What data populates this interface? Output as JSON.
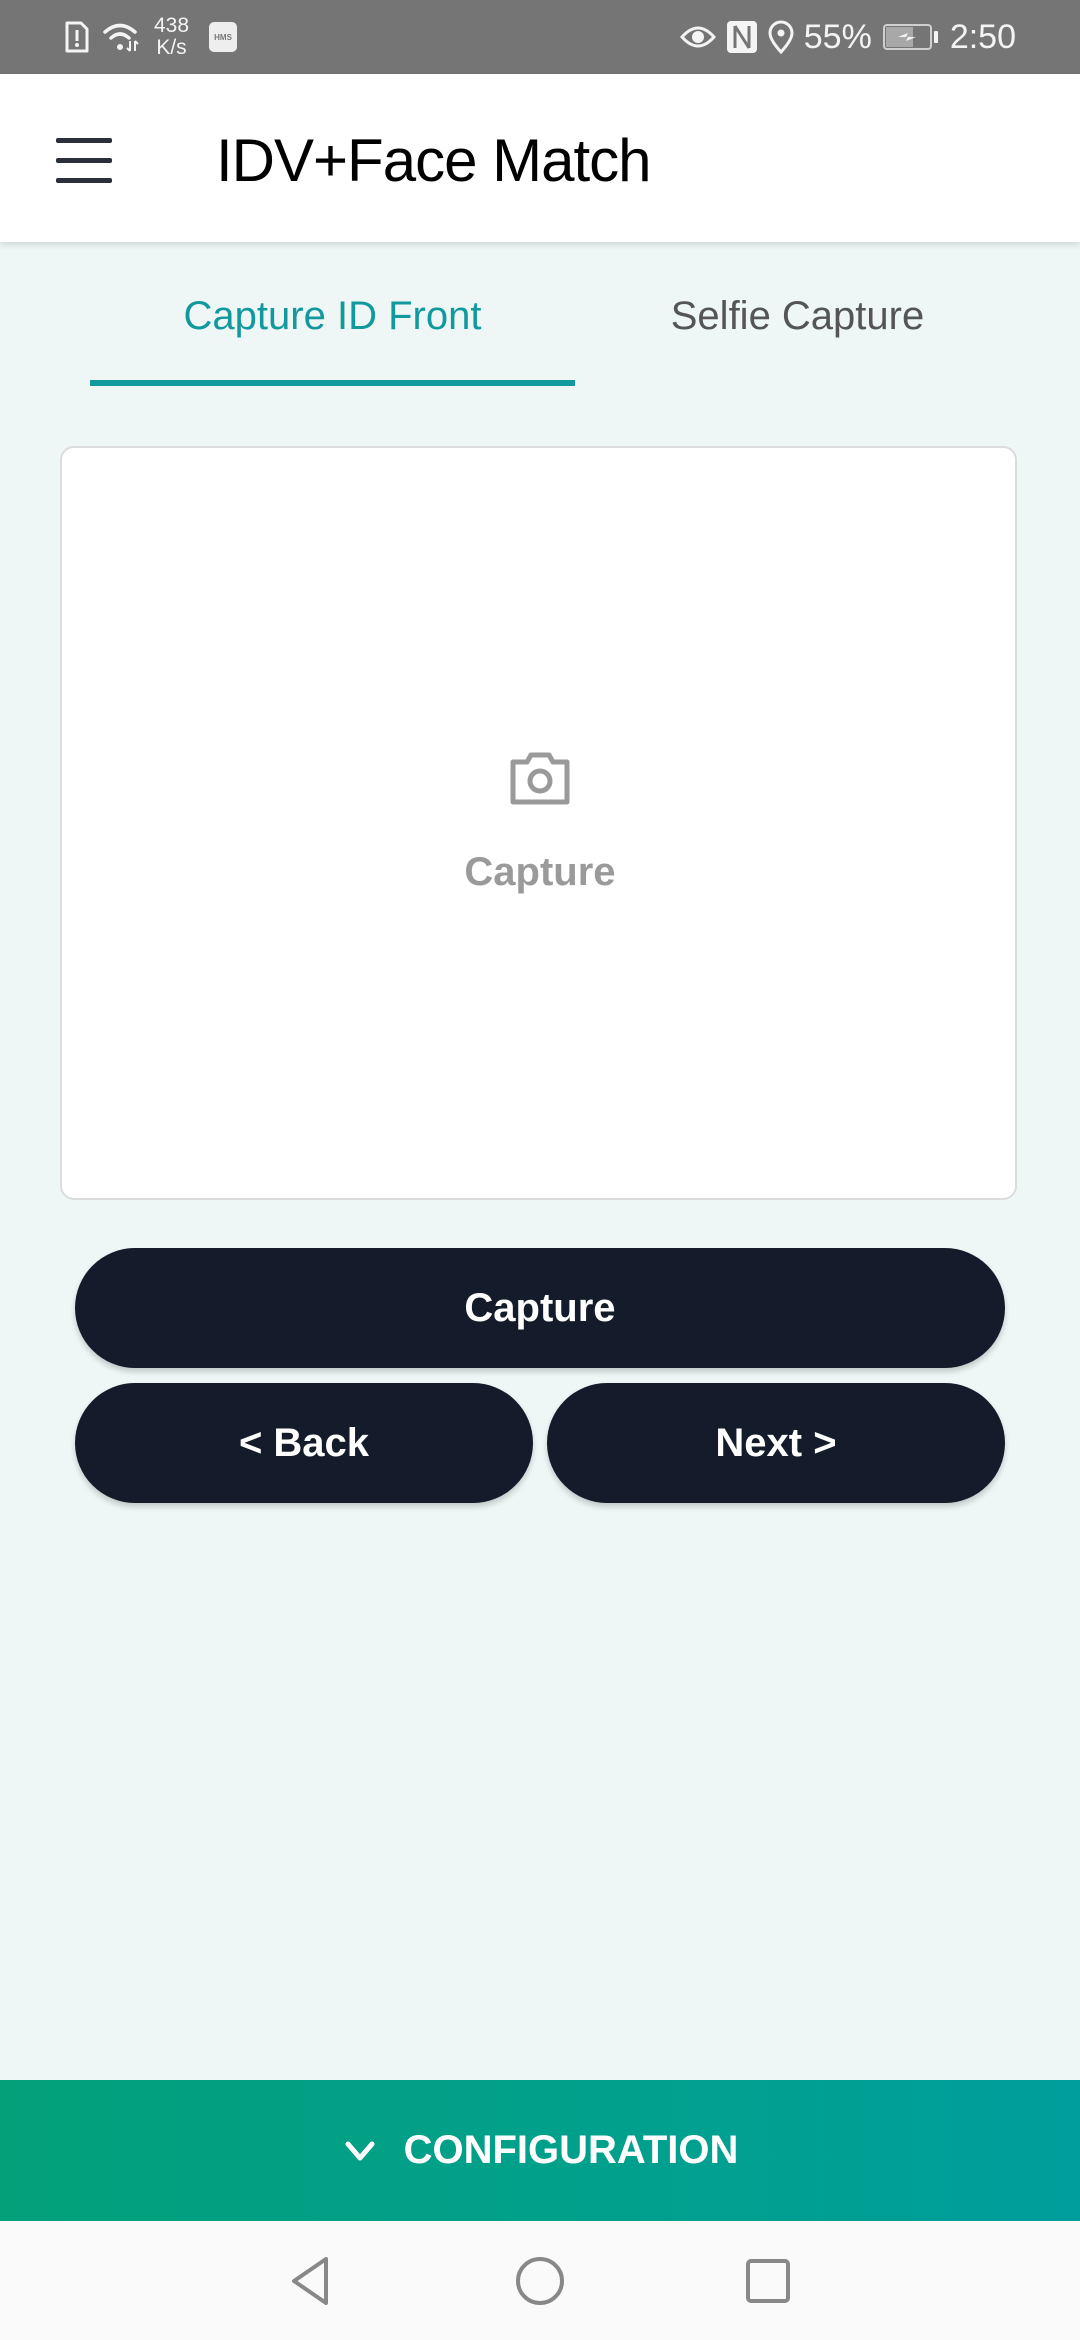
{
  "status_bar": {
    "net_speed_value": "438",
    "net_speed_unit": "K/s",
    "hms_badge": "HMS",
    "battery": "55%",
    "time": "2:50",
    "icons": [
      "sim-alert-icon",
      "wifi-icon",
      "hms-icon",
      "eye-icon",
      "nfc-icon",
      "location-icon",
      "battery-charging-icon"
    ]
  },
  "app_bar": {
    "menu_icon": "hamburger-menu-icon",
    "title": "IDV+Face Match"
  },
  "tabs": [
    {
      "label": "Capture ID Front",
      "active": true
    },
    {
      "label": "Selfie Capture",
      "active": false
    }
  ],
  "capture_area": {
    "icon": "camera-icon",
    "label": "Capture"
  },
  "buttons": {
    "capture": "Capture",
    "back": "< Back",
    "next": "Next >"
  },
  "config_bar": {
    "icon": "chevron-down-icon",
    "label": "CONFIGURATION"
  },
  "nav_bar": {
    "icons": [
      "back-triangle-icon",
      "home-circle-icon",
      "recents-square-icon"
    ]
  },
  "colors": {
    "accent": "#11999e",
    "button_bg": "#141c2b",
    "config_gradient_start": "#03a07a",
    "config_gradient_end": "#009e9c",
    "page_bg": "#eef6f6"
  }
}
